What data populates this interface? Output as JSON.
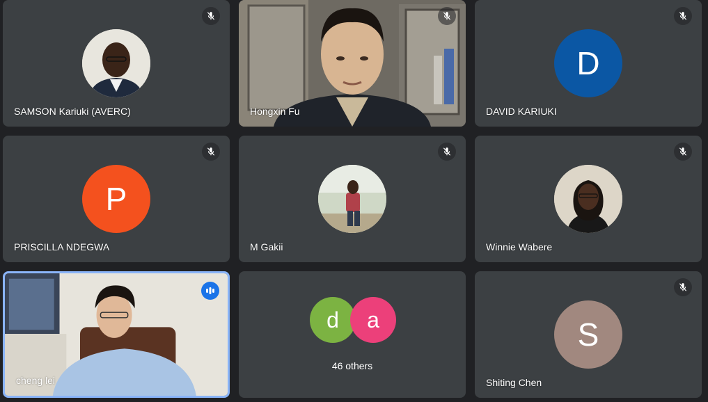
{
  "participants": [
    {
      "name": "SAMSON Kariuki (AVERC)",
      "avatar": "photo-man",
      "muted": true
    },
    {
      "name": "Hongxin Fu",
      "video": "man-in-office",
      "muted": true
    },
    {
      "name": "DAVID KARIUKI",
      "initial": "D",
      "color": "#0b57a4",
      "muted": true
    },
    {
      "name": "PRISCILLA NDEGWA",
      "initial": "P",
      "color": "#f4511e",
      "muted": true
    },
    {
      "name": "M Gakii",
      "avatar": "photo-woman-outdoor",
      "muted": true
    },
    {
      "name": "Winnie Wabere",
      "avatar": "photo-woman",
      "muted": true
    },
    {
      "name": "cheng lei",
      "video": "man-at-desk",
      "speaking": true
    },
    {
      "others": {
        "label": "46 others",
        "initials": [
          "d",
          "a"
        ],
        "colors": [
          "#7cb342",
          "#ec407a"
        ]
      }
    },
    {
      "name": "Shiting Chen",
      "initial": "S",
      "color": "#a1887f",
      "muted": true
    }
  ],
  "colors": {
    "tile": "#3c4043",
    "background": "#202124",
    "speaking_border": "#8ab4f8"
  }
}
